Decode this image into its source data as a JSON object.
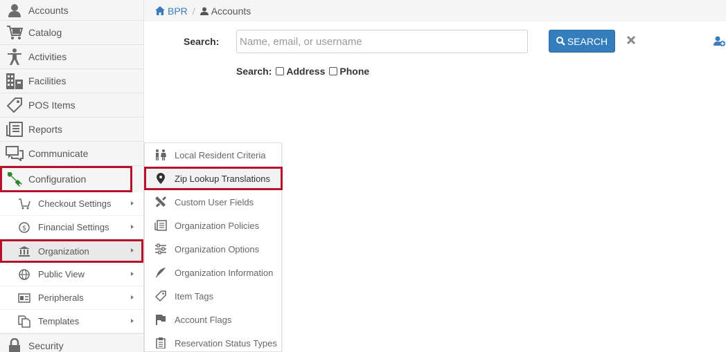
{
  "sidebar": {
    "items": [
      {
        "label": "Accounts",
        "icon": "user-icon"
      },
      {
        "label": "Catalog",
        "icon": "cart-icon"
      },
      {
        "label": "Activities",
        "icon": "person-icon"
      },
      {
        "label": "Facilities",
        "icon": "building-icon"
      },
      {
        "label": "POS Items",
        "icon": "tag-icon"
      },
      {
        "label": "Reports",
        "icon": "reports-icon"
      },
      {
        "label": "Communicate",
        "icon": "chat-icon"
      },
      {
        "label": "Configuration",
        "icon": "wrench-icon"
      }
    ],
    "config_sub": [
      {
        "label": "Checkout Settings",
        "icon": "cart-icon"
      },
      {
        "label": "Financial Settings",
        "icon": "dollar-icon"
      },
      {
        "label": "Organization",
        "icon": "bank-icon"
      },
      {
        "label": "Public View",
        "icon": "globe-icon"
      },
      {
        "label": "Peripherals",
        "icon": "id-card-icon"
      },
      {
        "label": "Templates",
        "icon": "copy-icon"
      }
    ],
    "bottom": {
      "label": "Security",
      "icon": "lock-icon"
    }
  },
  "flyout": {
    "items": [
      {
        "label": "Local Resident Criteria",
        "icon": "people-icon"
      },
      {
        "label": "Zip Lookup Translations",
        "icon": "map-pin-icon"
      },
      {
        "label": "Custom User Fields",
        "icon": "tools-icon"
      },
      {
        "label": "Organization Policies",
        "icon": "policies-icon"
      },
      {
        "label": "Organization Options",
        "icon": "sliders-icon"
      },
      {
        "label": "Organization Information",
        "icon": "feather-icon"
      },
      {
        "label": "Item Tags",
        "icon": "tag-icon"
      },
      {
        "label": "Account Flags",
        "icon": "flag-icon"
      },
      {
        "label": "Reservation Status Types",
        "icon": "clipboard-icon"
      }
    ]
  },
  "breadcrumb": {
    "home": "BPR",
    "separator": "/",
    "current": "Accounts"
  },
  "search": {
    "label": "Search:",
    "placeholder": "Name, email, or username",
    "button": "SEARCH",
    "options_label": "Search:",
    "option_address": "Address",
    "option_phone": "Phone"
  },
  "colors": {
    "accent": "#357ebd",
    "highlight": "#b5122e",
    "wrench": "#2a8a2a"
  }
}
